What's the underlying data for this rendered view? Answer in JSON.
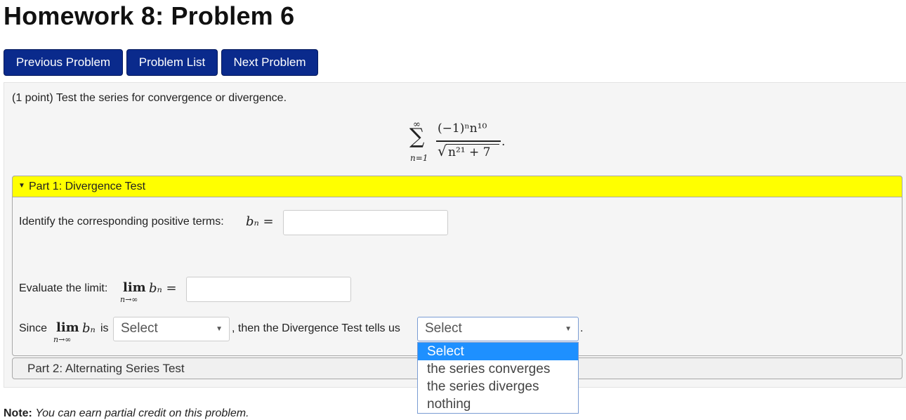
{
  "page": {
    "title": "Homework 8: Problem 6"
  },
  "nav": {
    "prev_label": "Previous Problem",
    "list_label": "Problem List",
    "next_label": "Next Problem"
  },
  "problem": {
    "intro": "(1 point) Test the series for convergence or divergence.",
    "series": {
      "sigma": "∑",
      "upper": "∞",
      "lower": "n=1",
      "numerator": "(−1)ⁿn¹⁰",
      "denominator_radicand": "n²¹ + 7",
      "radical_sign": "√",
      "trailing": "."
    }
  },
  "part1": {
    "header": "Part 1: Divergence Test",
    "q1_label": "Identify the corresponding positive terms:",
    "q1_math": "bₙ =",
    "q1_value": "",
    "q2_label": "Evaluate the limit:",
    "q2_lim": "lim",
    "q2_sub": "n→∞",
    "q2_math": "bₙ =",
    "q2_value": "",
    "q3_since": "Since",
    "q3_lim": "lim",
    "q3_sub": "n→∞",
    "q3_math": "bₙ",
    "q3_is": "is",
    "q3_select1": "Select",
    "q3_then": ", then the Divergence Test tells us",
    "q3_select2": "Select",
    "q3_end": "."
  },
  "dropdown": {
    "options": [
      "Select",
      "the series converges",
      "the series diverges",
      "nothing"
    ],
    "highlighted_index": 0,
    "highlight_color": "#1e90ff"
  },
  "part2": {
    "header": "Part 2: Alternating Series Test"
  },
  "note": {
    "bold": "Note:",
    "text": "You can earn partial credit on this problem."
  },
  "colors": {
    "button_bg": "#0a2a8c",
    "part1_header_bg": "#ffff00"
  }
}
